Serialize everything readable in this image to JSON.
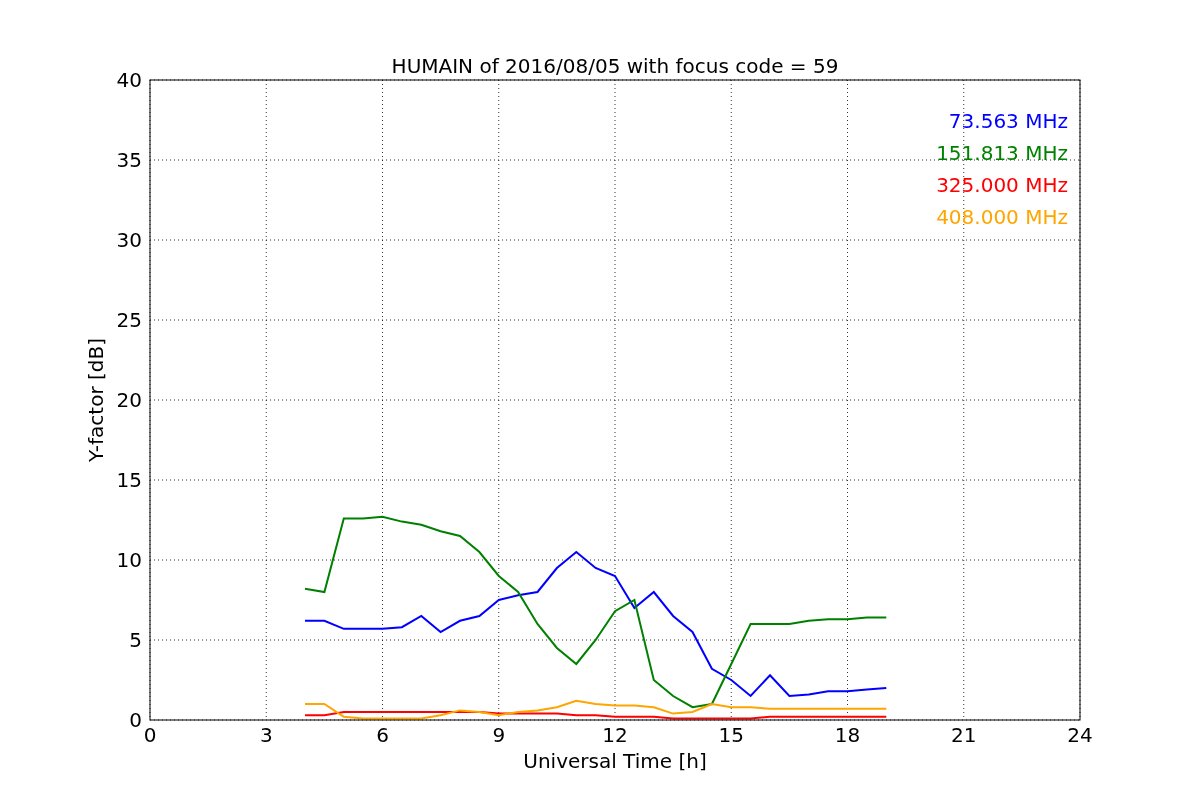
{
  "chart_data": {
    "type": "line",
    "title": "HUMAIN of 2016/08/05 with focus code = 59",
    "xlabel": "Universal Time [h]",
    "ylabel": "Y-factor [dB]",
    "x": [
      4,
      4.5,
      5,
      5.5,
      6,
      6.5,
      7,
      7.5,
      8,
      8.5,
      9,
      9.5,
      10,
      10.5,
      11,
      11.5,
      12,
      12.5,
      13,
      13.5,
      14,
      14.5,
      15,
      15.5,
      16,
      16.5,
      17,
      17.5,
      18,
      18.5,
      19
    ],
    "series": [
      {
        "name": "73.563 MHz",
        "color": "#0000ff",
        "values": [
          6.2,
          6.2,
          5.7,
          5.7,
          5.7,
          5.8,
          6.5,
          5.5,
          6.2,
          6.5,
          7.5,
          7.8,
          8.0,
          9.5,
          10.5,
          9.5,
          9.0,
          7.0,
          8.0,
          6.5,
          5.5,
          3.2,
          2.5,
          1.5,
          2.8,
          1.5,
          1.6,
          1.8,
          1.8,
          1.9,
          2.0
        ]
      },
      {
        "name": "151.813 MHz",
        "color": "#008000",
        "values": [
          8.2,
          8.0,
          12.6,
          12.6,
          12.7,
          12.4,
          12.2,
          11.8,
          11.5,
          10.5,
          9.0,
          8.0,
          6.0,
          4.5,
          3.5,
          5.0,
          6.8,
          7.5,
          2.5,
          1.5,
          0.8,
          1.0,
          3.5,
          6.0,
          6.0,
          6.0,
          6.2,
          6.3,
          6.3,
          6.4,
          6.4
        ]
      },
      {
        "name": "325.000 MHz",
        "color": "#ff0000",
        "values": [
          0.3,
          0.3,
          0.5,
          0.5,
          0.5,
          0.5,
          0.5,
          0.5,
          0.5,
          0.5,
          0.4,
          0.4,
          0.4,
          0.4,
          0.3,
          0.3,
          0.2,
          0.2,
          0.2,
          0.1,
          0.1,
          0.1,
          0.1,
          0.1,
          0.2,
          0.2,
          0.2,
          0.2,
          0.2,
          0.2,
          0.2
        ]
      },
      {
        "name": "408.000 MHz",
        "color": "#ffa500",
        "values": [
          1.0,
          1.0,
          0.2,
          0.1,
          0.1,
          0.1,
          0.1,
          0.3,
          0.6,
          0.5,
          0.3,
          0.5,
          0.6,
          0.8,
          1.2,
          1.0,
          0.9,
          0.9,
          0.8,
          0.4,
          0.5,
          1.0,
          0.8,
          0.8,
          0.7,
          0.7,
          0.7,
          0.7,
          0.7,
          0.7,
          0.7
        ]
      }
    ],
    "grid": true,
    "xlim": [
      0,
      24
    ],
    "ylim": [
      0,
      40
    ],
    "xticks": [
      0,
      3,
      6,
      9,
      12,
      15,
      18,
      21,
      24
    ],
    "yticks": [
      0,
      5,
      10,
      15,
      20,
      25,
      30,
      35,
      40
    ]
  }
}
